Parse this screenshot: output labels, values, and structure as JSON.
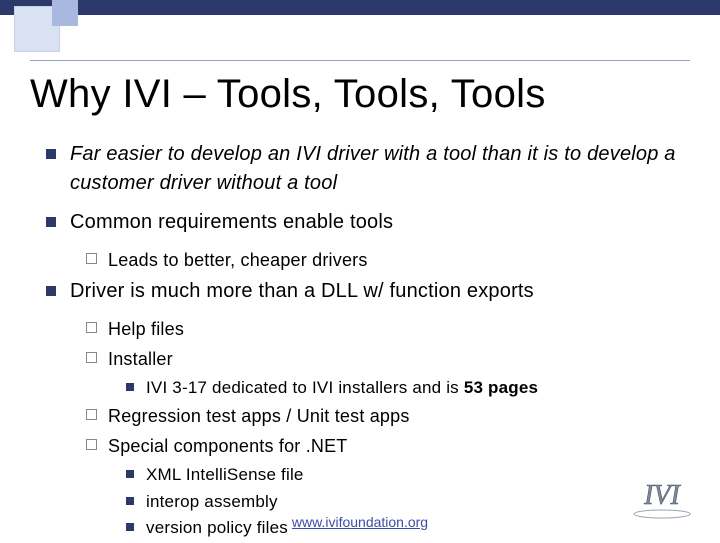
{
  "title": "Why IVI – Tools, Tools, Tools",
  "bullets": {
    "b1_0": "Far easier to develop an IVI driver with a tool than it is to develop a customer driver without a tool",
    "b1_1": "Common requirements enable tools",
    "b2_0": "Leads to better, cheaper drivers",
    "b1_2": "Driver is much more than a DLL w/ function exports",
    "b2_1": "Help files",
    "b2_2": "Installer",
    "b3_0a": "IVI 3-17 dedicated to IVI installers and is ",
    "b3_0b": "53 pages",
    "b2_3": "Regression test apps / Unit test apps",
    "b2_4": "Special components for .NET",
    "b3_1": "XML IntelliSense file",
    "b3_2": "interop assembly",
    "b3_3": "version policy files"
  },
  "footer": {
    "url_text": "www.ivifoundation.org",
    "url_href": "http://www.ivifoundation.org"
  },
  "logo_alt": "IVI"
}
